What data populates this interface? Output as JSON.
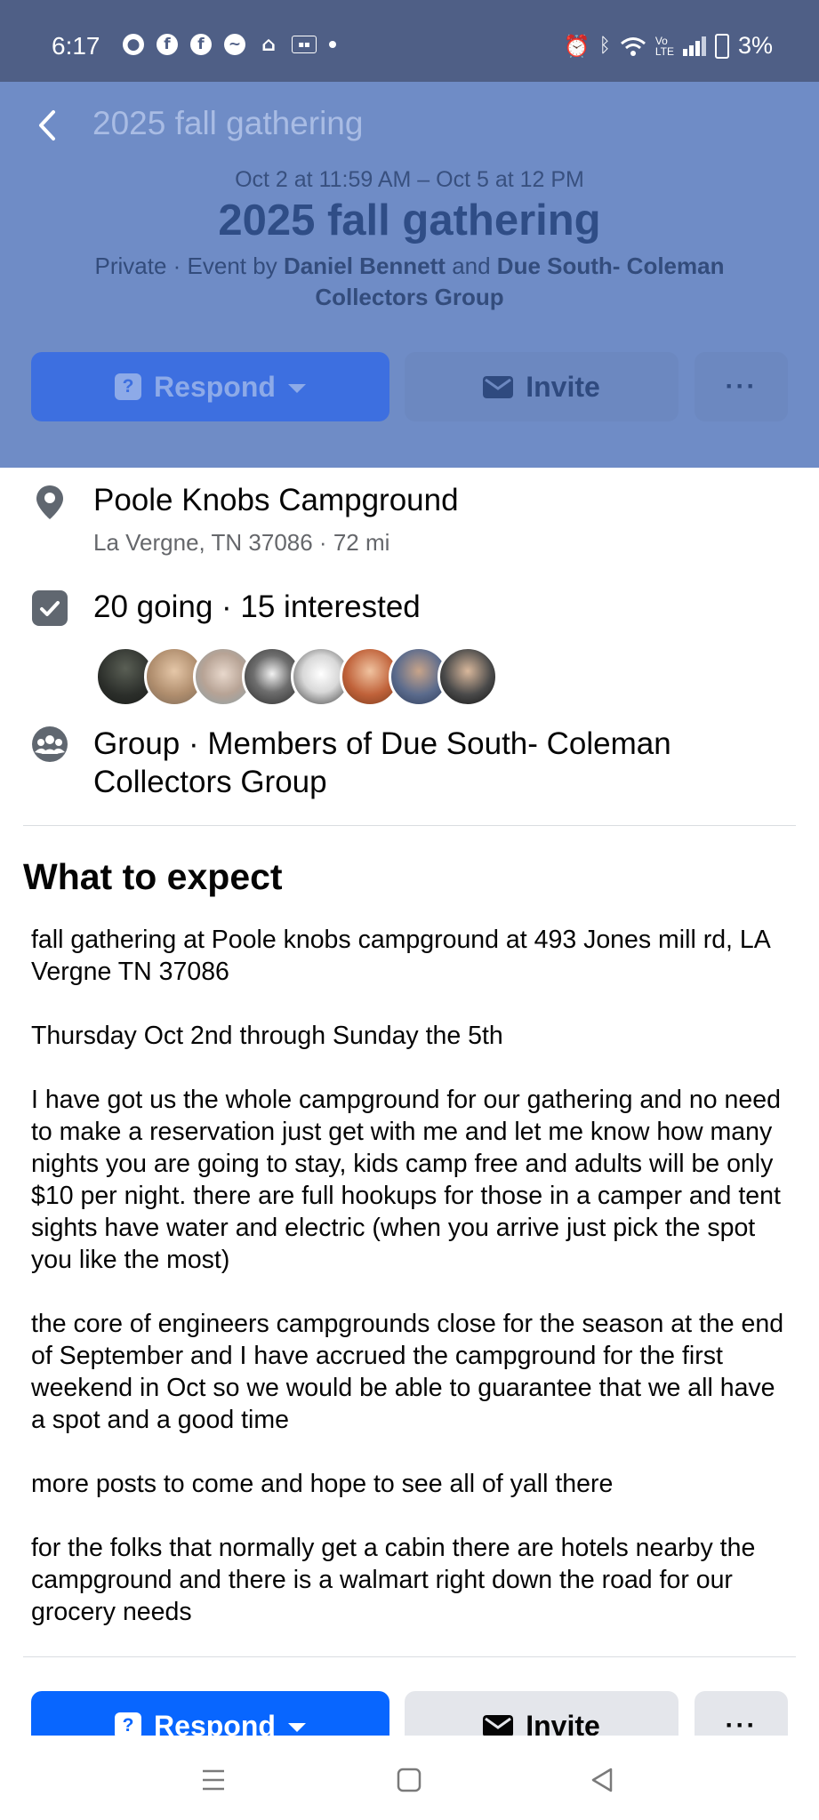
{
  "status_bar": {
    "time": "6:17",
    "battery": "3%"
  },
  "header": {
    "back_title": "2025 fall gathering",
    "date_range": "Oct 2 at 11:59 AM – Oct 5 at 12 PM",
    "title": "2025 fall gathering",
    "privacy": "Private · Event by ",
    "host1": "Daniel Bennett",
    "and": " and ",
    "host2": "Due South- Coleman Collectors Group",
    "respond_label": "Respond",
    "invite_label": "Invite"
  },
  "location": {
    "name": "Poole Knobs Campground",
    "address": "La Vergne, TN 37086 · 72 mi"
  },
  "attendance": {
    "summary": "20 going · 15 interested"
  },
  "audience": {
    "text": "Group · Members of Due South- Coleman Collectors Group"
  },
  "about": {
    "heading": "What to expect",
    "paragraphs": [
      "fall gathering at Poole knobs campground at 493 Jones mill rd, LA Vergne TN 37086",
      "Thursday Oct 2nd through Sunday the 5th",
      "I have got us the whole campground for our gathering and no need to make a reservation just get with me and let me know how many nights you are going to stay, kids camp free and adults will be only $10 per night. there are full hookups for those in a camper and tent sights have water and electric (when you arrive just pick the spot you like the most)",
      "the core of engineers campgrounds close for the season at the end of September and I have accrued the campground for the first weekend in Oct so we would be able to guarantee that we all have a spot and a good time",
      "more posts to come and hope to see all of yall there",
      " for the folks that normally get a cabin there are hotels nearby the campground and there is a walmart right down the road for our grocery needs"
    ]
  },
  "bottom_actions": {
    "respond_label": "Respond",
    "invite_label": "Invite"
  },
  "colors": {
    "accent": "#0866ff",
    "header_overlay": "#6f8cc6"
  }
}
